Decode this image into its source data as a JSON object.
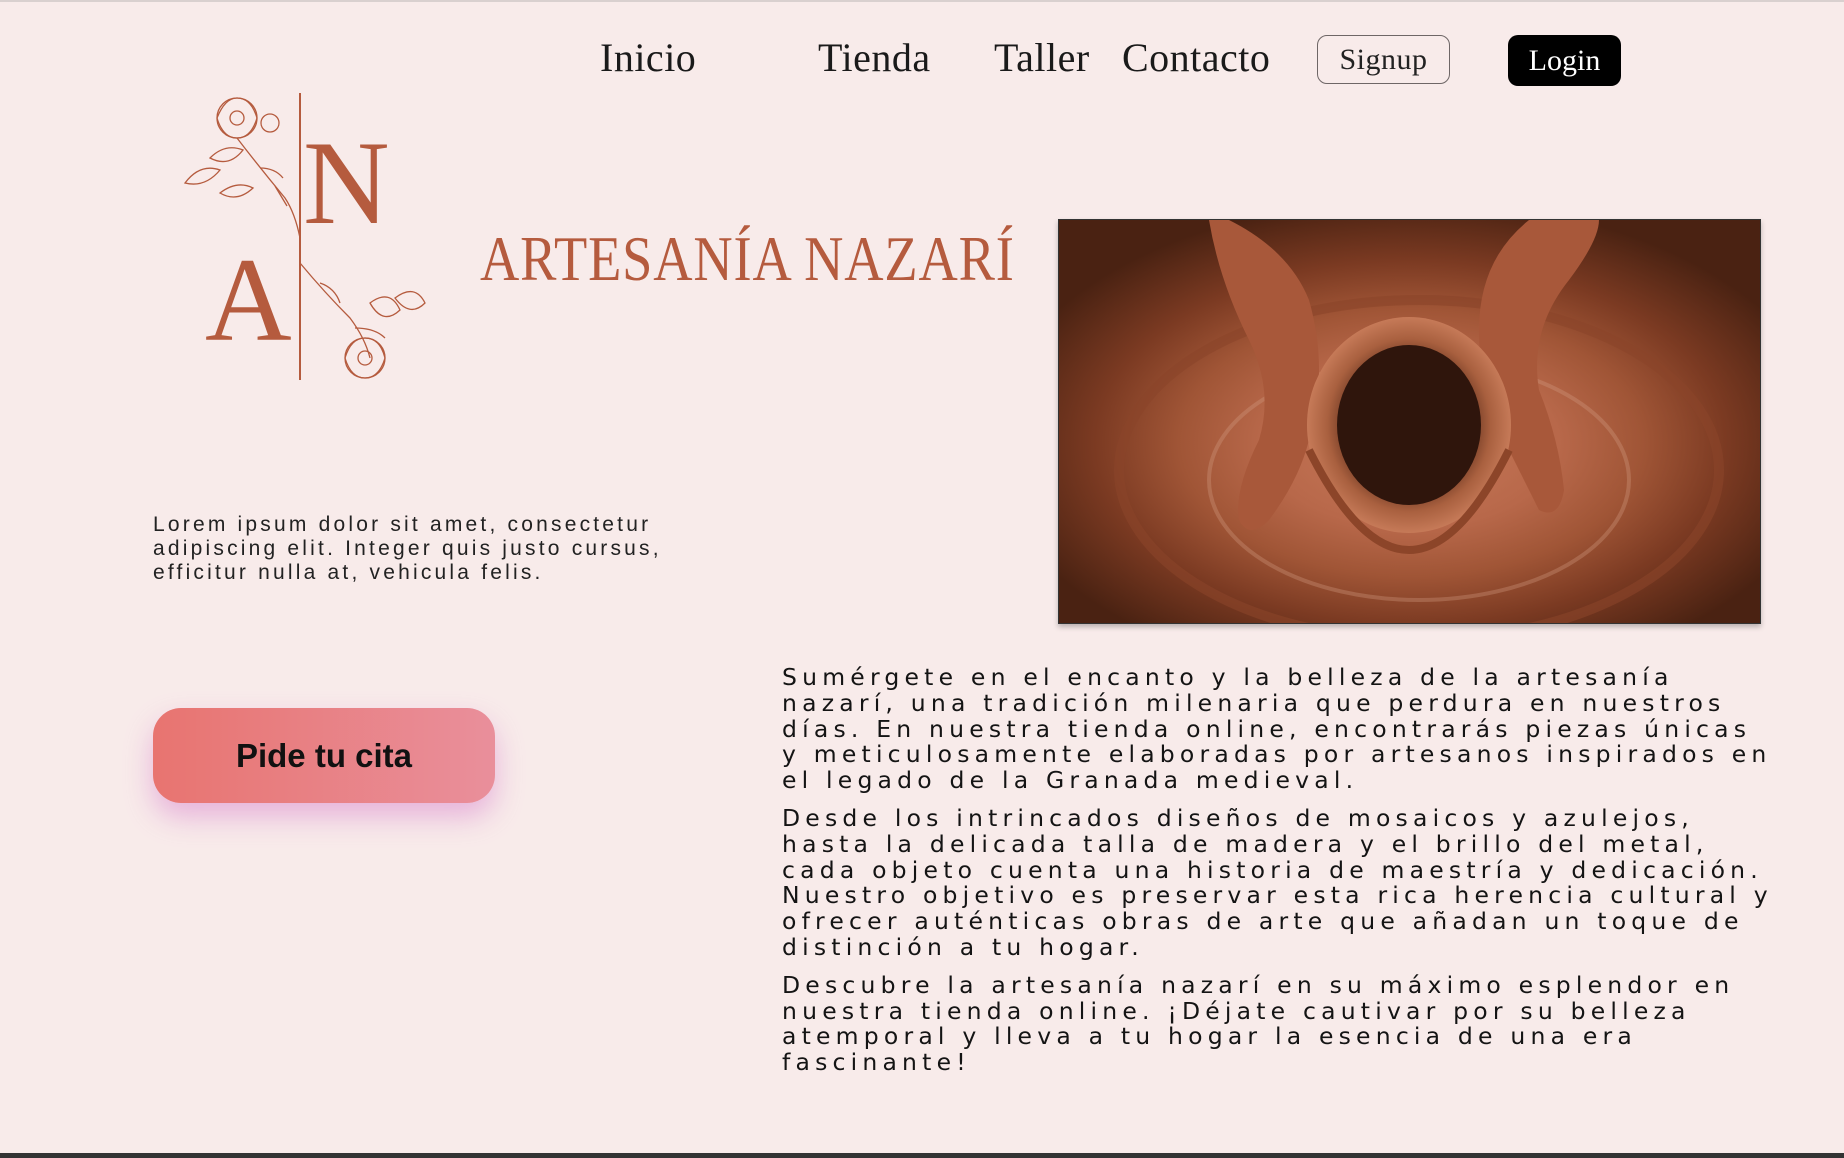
{
  "nav": {
    "links": [
      "Inicio",
      "Tienda",
      "Taller",
      "Contacto"
    ],
    "signup_label": "Signup",
    "login_label": "Login"
  },
  "brand": {
    "monogram_top": "N",
    "monogram_bottom": "A",
    "name": "ARTESANÍA NAZARÍ",
    "color": "#b55b3e"
  },
  "intro": {
    "text": "Lorem ipsum dolor sit amet, consectetur adipiscing elit. Integer quis justo cursus, efficitur nulla at, vehicula felis."
  },
  "cta": {
    "label": "Pide tu cita"
  },
  "description": {
    "paragraphs": [
      "Sumérgete en el encanto y la belleza de la artesanía nazarí, una tradición milenaria que perdura en nuestros días. En nuestra tienda online, encontrarás piezas únicas y meticulosamente elaboradas por artesanos inspirados en el legado de la Granada medieval.",
      "Desde los intrincados diseños de mosaicos y azulejos, hasta la delicada talla de madera y el brillo del metal, cada objeto cuenta una historia de maestría y dedicación. Nuestro objetivo es preservar esta rica herencia cultural y ofrecer auténticas obras de arte que añadan un toque de distinción a tu hogar.",
      "Descubre la artesanía nazarí en su máximo esplendor en nuestra tienda online. ¡Déjate cautivar por su belleza atemporal y lleva a tu hogar la esencia de una era fascinante!"
    ]
  }
}
